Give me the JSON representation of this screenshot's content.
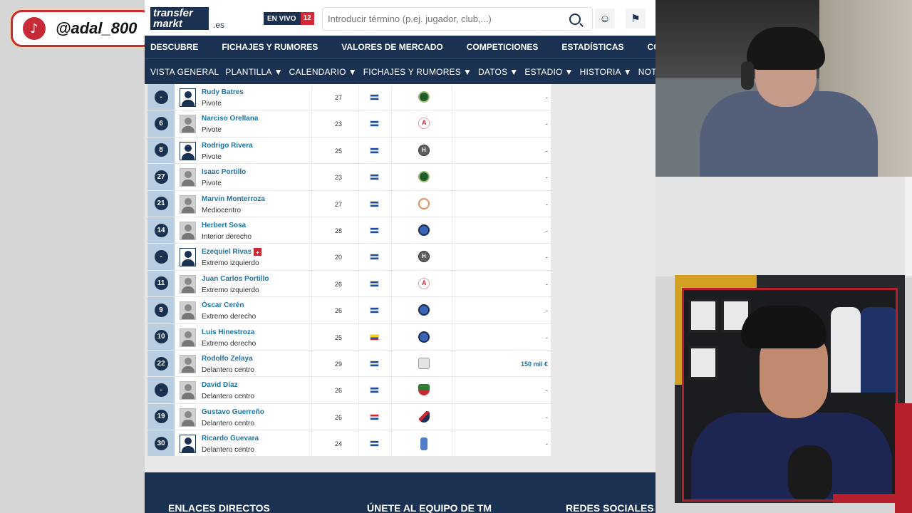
{
  "overlay": {
    "tiktok_handle": "@adal_800",
    "tiktok_icon": "tiktok-icon"
  },
  "site": {
    "logo_line1": "transfer",
    "logo_line2": "markt",
    "logo_domain": ".es",
    "live_label": "EN VIVO",
    "live_count": "12",
    "search_placeholder": "Introducir término (p.ej. jugador, club,...)",
    "main_nav": [
      "DESCUBRE",
      "FICHAJES Y RUMORES",
      "VALORES DE MERCADO",
      "COMPETICIONES",
      "ESTADÍSTICAS",
      "COMUNIDAD"
    ],
    "sub_nav": [
      {
        "label": "VISTA GENERAL",
        "caret": ""
      },
      {
        "label": "PLANTILLA",
        "caret": "▼"
      },
      {
        "label": "CALENDARIO",
        "caret": "▼"
      },
      {
        "label": "FICHAJES Y RUMORES",
        "caret": "▼"
      },
      {
        "label": "DATOS",
        "caret": "▼"
      },
      {
        "label": "ESTADIO",
        "caret": "▼"
      },
      {
        "label": "HISTORIA",
        "caret": "▼"
      },
      {
        "label": "NOTICIAS",
        "caret": ""
      }
    ]
  },
  "players": [
    {
      "number": "-",
      "name": "Rudy Batres",
      "position": "Pivote",
      "age": "27",
      "flag": "sv",
      "club": "green",
      "value": "-",
      "photo": "empty",
      "injury": false
    },
    {
      "number": "6",
      "name": "Narciso Orellana",
      "position": "Pivote",
      "age": "23",
      "flag": "sv",
      "club": "red",
      "value": "-",
      "photo": "face",
      "injury": false
    },
    {
      "number": "8",
      "name": "Rodrigo Rivera",
      "position": "Pivote",
      "age": "25",
      "flag": "sv",
      "club": "h",
      "value": "-",
      "photo": "empty",
      "injury": false
    },
    {
      "number": "27",
      "name": "Isaac Portillo",
      "position": "Pivote",
      "age": "23",
      "flag": "sv",
      "club": "green",
      "value": "-",
      "photo": "face",
      "injury": false
    },
    {
      "number": "21",
      "name": "Marvin Monterroza",
      "position": "Mediocentro",
      "age": "27",
      "flag": "sv",
      "club": "orange",
      "value": "-",
      "photo": "face",
      "injury": false
    },
    {
      "number": "14",
      "name": "Herbert Sosa",
      "position": "Interior derecho",
      "age": "28",
      "flag": "sv",
      "club": "blue",
      "value": "-",
      "photo": "face",
      "injury": false
    },
    {
      "number": "-",
      "name": "Ezequiel Rivas",
      "position": "Extremo izquierdo",
      "age": "20",
      "flag": "sv",
      "club": "h",
      "value": "-",
      "photo": "empty",
      "injury": true
    },
    {
      "number": "11",
      "name": "Juan Carlos Portillo",
      "position": "Extremo izquierdo",
      "age": "26",
      "flag": "sv",
      "club": "red",
      "value": "-",
      "photo": "face",
      "injury": false
    },
    {
      "number": "9",
      "name": "Óscar Cerén",
      "position": "Extremo derecho",
      "age": "26",
      "flag": "sv",
      "club": "blue",
      "value": "-",
      "photo": "face",
      "injury": false
    },
    {
      "number": "10",
      "name": "Luis Hinestroza",
      "position": "Extremo derecho",
      "age": "25",
      "flag": "co",
      "club": "blue",
      "value": "-",
      "photo": "face",
      "injury": false
    },
    {
      "number": "22",
      "name": "Rodolfo Zelaya",
      "position": "Delantero centro",
      "age": "29",
      "flag": "sv",
      "club": "grey",
      "value": "150 mil €",
      "photo": "face",
      "injury": false
    },
    {
      "number": "-",
      "name": "David Díaz",
      "position": "Delantero centro",
      "age": "26",
      "flag": "sv",
      "club": "shield",
      "value": "-",
      "photo": "face",
      "injury": false
    },
    {
      "number": "19",
      "name": "Gustavo Guerreño",
      "position": "Delantero centro",
      "age": "26",
      "flag": "py",
      "club": "py",
      "value": "-",
      "photo": "face",
      "injury": false
    },
    {
      "number": "30",
      "name": "Ricardo Guevara",
      "position": "Delantero centro",
      "age": "24",
      "flag": "sv",
      "club": "tall",
      "value": "-",
      "photo": "empty",
      "injury": false
    }
  ],
  "footer": {
    "col1": "ENLACES DIRECTOS",
    "col2": "ÚNETE AL EQUIPO DE TM",
    "col3": "REDES SOCIALES"
  },
  "icons": {
    "search": "search-icon",
    "user": "user-search-icon",
    "bookmark": "bookmark-icon",
    "injury": "injury-cross-icon"
  },
  "colors": {
    "navy": "#1a3151",
    "link": "#1d75a3",
    "accent_red": "#c62a36"
  }
}
